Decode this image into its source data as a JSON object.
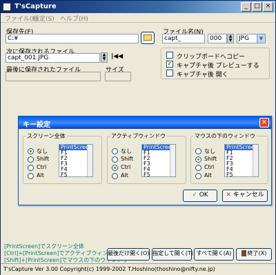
{
  "window": {
    "title": "T'sCapture"
  },
  "menu": [
    "ファイル(F)",
    "設定(S)",
    "ヘルプ(H)"
  ],
  "save": {
    "label": "保存先(F)",
    "path": "C:¥"
  },
  "filename": {
    "label": "ファイル名(N)",
    "value": "capt_",
    "number": "000",
    "format": "JPG"
  },
  "next_file": {
    "label": "次に保存されるファイル",
    "value": "capt_001.JPG"
  },
  "last_file": {
    "label": "最後に保存されたファイル",
    "size_label": "サイズ"
  },
  "options": [
    {
      "label": "クリップボードへコピー",
      "checked": false
    },
    {
      "label": "キャプチャ後 プレビューする",
      "checked": true
    },
    {
      "label": "キャプチャ後 開く",
      "checked": false
    }
  ],
  "dialog": {
    "title": "キー設定",
    "groups": [
      {
        "title": "スクリーン全体",
        "selected": "なし",
        "radios": [
          "なし",
          "Shift",
          "Ctrl",
          "Alt"
        ],
        "keys": [
          "PrintScreen",
          "F1",
          "F2",
          "F3",
          "F4",
          "F5"
        ]
      },
      {
        "title": "アクティブウィンドウ",
        "selected": "Ctrl",
        "radios": [
          "なし",
          "Shift",
          "Ctrl",
          "Alt"
        ],
        "keys": [
          "PrintScreen",
          "F1",
          "F2",
          "F3",
          "F4",
          "F5"
        ]
      },
      {
        "title": "マウスの下のウィンドウ",
        "selected": "Shift",
        "radios": [
          "なし",
          "Shift",
          "Ctrl",
          "Alt"
        ],
        "keys": [
          "PrintScreen",
          "F1",
          "F2",
          "F3",
          "F4",
          "F5"
        ]
      }
    ],
    "ok": "OK",
    "cancel": "キャンセル"
  },
  "hints": [
    "[PrintScreen]でスクリーン全体",
    "[Ctrl]+[PrintScreen]でアクティブウィンドウ",
    "[Shift]+[PrintScreen]でマウスの下のウィンドウ"
  ],
  "buttons": {
    "open_last": "最後だけ開く(O)",
    "open_select": "指定して開く(T)",
    "open_all": "すべて開く(A)",
    "exit": "終了(X)"
  },
  "status": "T'sCapture Ver 3.00 Copyright(c) 1999-2002 T.Hoshino(thoshino@nifty.ne.jp)",
  "colors": {
    "title_bar": "#0a246a",
    "dialog_title": "#0058ee",
    "hint_text": "#008080",
    "selection": "#316ac5"
  }
}
